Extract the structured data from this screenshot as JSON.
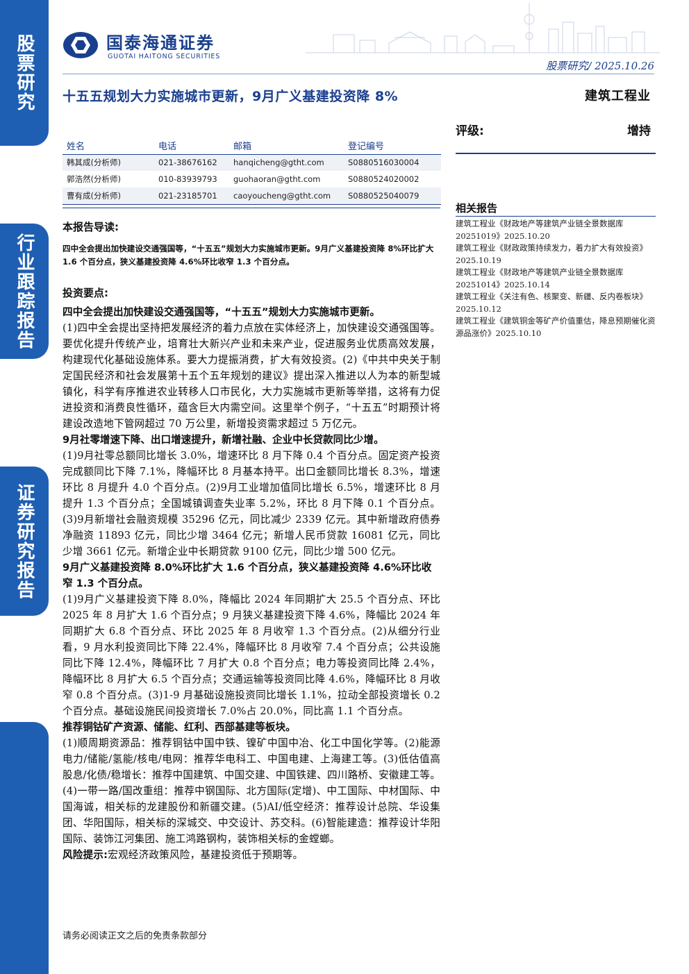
{
  "side_tabs": [
    "股票研究",
    "行业跟踪报告",
    "证券研究报告"
  ],
  "brand": {
    "name_cn": "国泰海通证券",
    "name_en": "GUOTAI HAITONG SECURITIES"
  },
  "header_meta": "股票研究/ 2025.10.26",
  "title": "十五五规划大力实施城市更新，9月广义基建投资降 8%",
  "industry": "建筑工程业",
  "analysts": {
    "headers": [
      "姓名",
      "电话",
      "邮箱",
      "登记编号"
    ],
    "rows": [
      [
        "韩其成(分析师)",
        "021-38676162",
        "hanqicheng@gtht.com",
        "S0880516030004"
      ],
      [
        "郭浩然(分析师)",
        "010-83939793",
        "guohaoran@gtht.com",
        "S0880524020002"
      ],
      [
        "曹有成(分析师)",
        "021-23185701",
        "caoyoucheng@gtht.com",
        "S0880525040079"
      ]
    ]
  },
  "rating": {
    "label": "评级:",
    "value": "增持"
  },
  "related": {
    "title": "相关报告",
    "items": [
      "建筑工程业《财政地产等建筑产业链全景数据库 20251019》2025.10.20",
      "建筑工程业《财政政策持续发力，着力扩大有效投资》2025.10.19",
      "建筑工程业《财政地产等建筑产业链全景数据库 20251014》2025.10.14",
      "建筑工程业《关注有色、核聚变、新疆、反内卷板块》2025.10.12",
      "建筑工程业《建筑铜金等矿产价值重估，降息预期催化资源品涨价》2025.10.10"
    ]
  },
  "guide": {
    "heading": "本报告导读:",
    "text": "四中全会提出加快建设交通强国等，“十五五”规划大力实施城市更新。9月广义基建投资降 8%环比扩大 1.6 个百分点，狭义基建投资降 4.6%环比收窄 1.3 个百分点。"
  },
  "key_points": {
    "heading": "投资要点:",
    "p1_head": "四中全会提出加快建设交通强国等，“十五五”规划大力实施城市更新。",
    "p1_body": "(1)四中全会提出坚持把发展经济的着力点放在实体经济上，加快建设交通强国等。要优化提升传统产业，培育壮大新兴产业和未来产业，促进服务业优质高效发展，构建现代化基础设施体系。要大力提振消费，扩大有效投资。(2)《中共中央关于制定国民经济和社会发展第十五个五年规划的建议》提出深入推进以人为本的新型城镇化，科学有序推进农业转移人口市民化，大力实施城市更新等举措，这将有力促进投资和消费良性循环，蕴含巨大内需空间。这里举个例子，“十五五”时期预计将建设改造地下管网超过 70 万公里，新增投资需求超过 5 万亿元。",
    "p2_head": "9月社零增速下降、出口增速提升，新增社融、企业中长贷款同比少增。",
    "p2_body": "(1)9月社零总额同比增长 3.0%，增速环比 8 月下降 0.4 个百分点。固定资产投资完成额同比下降 7.1%，降幅环比 8 月基本持平。出口金额同比增长 8.3%，增速环比 8 月提升 4.0 个百分点。(2)9月工业增加值同比增长 6.5%，增速环比 8 月提升 1.3 个百分点；全国城镇调查失业率 5.2%，环比 8 月下降 0.1 个百分点。(3)9月新增社会融资规模 35296 亿元，同比减少 2339 亿元。其中新增政府债券净融资 11893 亿元，同比少增 3464 亿元；新增人民币贷款 16081 亿元，同比少增 3661 亿元。新增企业中长期贷款 9100 亿元，同比少增 500 亿元。",
    "p3_head": "9月广义基建投资降 8.0%环比扩大 1.6 个百分点，狭义基建投资降 4.6%环比收窄 1.3 个百分点。",
    "p3_body": "(1)9月广义基建投资下降 8.0%，降幅比 2024 年同期扩大 25.5 个百分点、环比 2025 年 8 月扩大 1.6 个百分点；9 月狭义基建投资下降 4.6%，降幅比 2024 年同期扩大 6.8 个百分点、环比 2025 年 8 月收窄 1.3 个百分点。(2)从细分行业看，9 月水利投资同比下降 22.4%，降幅环比 8 月收窄 7.4 个百分点；公共设施同比下降 12.4%，降幅环比 7 月扩大 0.8 个百分点；电力等投资同比降 2.4%，降幅环比 8 月扩大 6.5 个百分点；交通运输等投资同比降 4.6%，降幅环比 8 月收窄 0.8 个百分点。(3)1-9 月基础设施投资同比增长 1.1%，拉动全部投资增长 0.2 个百分点。基础设施民间投资增长 7.0%占 20.0%，同比高 1.1 个百分点。",
    "p4_head": "推荐铜钴矿产资源、储能、红利、西部基建等板块。",
    "p4_body": "(1)顺周期资源品：推荐铜钴中国中铁、镍矿中国中冶、化工中国化学等。(2)能源电力/储能/氢能/核电/电网：推荐华电科工、中国电建、上海建工等。(3)低估值高股息/化债/稳增长：推荐中国建筑、中国交建、中国铁建、四川路桥、安徽建工等。(4)一带一路/国改重组：推荐中钢国际、北方国际(定增)、中工国际、中材国际、中国海诚，相关标的龙建股份和新疆交建。(5)AI/低空经济：推荐设计总院、华设集团、华阳国际，相关标的深城交、中交设计、苏交科。(6)智能建造：推荐设计华阳国际、装饰江河集团、施工鸿路钢构，装饰相关标的金螳螂。",
    "risk_head": "风险提示:",
    "risk_body": "宏观经济政策风险，基建投资低于预期等。"
  },
  "footer_note": "请务必阅读正文之后的免责条款部分",
  "colors": {
    "brand_blue": "#1a3f8e",
    "tab_blue": "#1f5fb3"
  }
}
